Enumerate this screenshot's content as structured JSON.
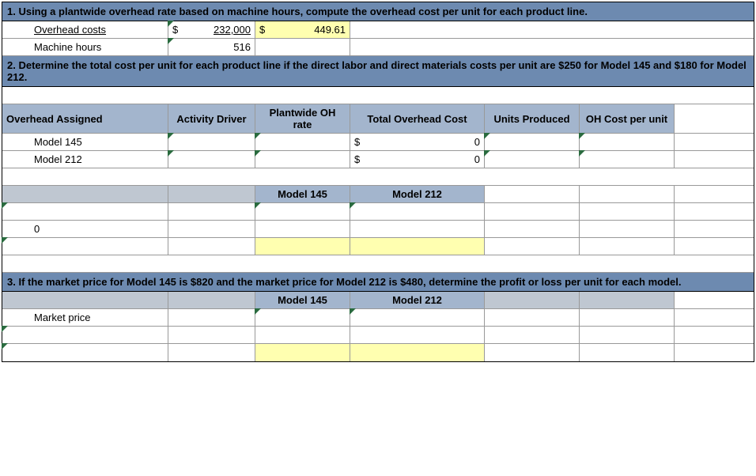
{
  "q1": {
    "prompt": "1. Using a plantwide overhead rate based on machine hours, compute the overhead cost per unit for each product line.",
    "labels": {
      "overhead_costs": "Overhead costs",
      "machine_hours": "Machine hours"
    },
    "overhead_cost_currency": "$",
    "overhead_cost_value": "232,000",
    "rate_currency": "$",
    "rate_value": "449.61",
    "machine_hours_value": "516"
  },
  "q2": {
    "prompt": "2.  Determine the total cost per unit for each product line if the direct labor and direct materials costs per unit are $250 for Model 145 and $180 for Model 212.",
    "headers": {
      "overhead_assigned": "Overhead Assigned",
      "activity_driver": "Activity Driver",
      "plantwide_oh_rate": "Plantwide OH rate",
      "total_overhead_cost": "Total Overhead Cost",
      "units_produced": "Units Produced",
      "oh_cost_per_unit": "OH Cost per unit"
    },
    "rows": {
      "model145": {
        "label": "Model 145",
        "currency": "$",
        "total_oh": "0"
      },
      "model212": {
        "label": "Model 212",
        "currency": "$",
        "total_oh": "0"
      }
    },
    "summary": {
      "model145_header": "Model 145",
      "model212_header": "Model 212",
      "zero_label": "0"
    }
  },
  "q3": {
    "prompt": "3.  If the market price for Model 145 is $820 and the market price for Model 212 is $480, determine the profit or loss per unit for each model.",
    "headers": {
      "model145": "Model 145",
      "model212": "Model 212"
    },
    "labels": {
      "market_price": "Market price"
    }
  }
}
